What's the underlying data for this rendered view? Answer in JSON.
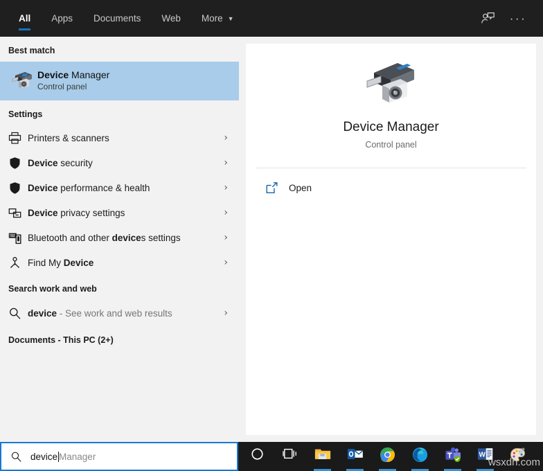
{
  "header": {
    "tabs": [
      {
        "label": "All",
        "active": true,
        "has_caret": false
      },
      {
        "label": "Apps",
        "active": false,
        "has_caret": false
      },
      {
        "label": "Documents",
        "active": false,
        "has_caret": false
      },
      {
        "label": "Web",
        "active": false,
        "has_caret": false
      },
      {
        "label": "More",
        "active": false,
        "has_caret": true
      }
    ],
    "caret_glyph": "▼",
    "feedback_icon": "feedback-person-icon",
    "more_options_icon": "ellipsis-icon",
    "more_options_glyph": "···",
    "background": "#1f1f1f",
    "accent": "#1773c0"
  },
  "left_panel": {
    "best_match": {
      "section_label": "Best match",
      "title_bold": "Device",
      "title_rest": " Manager",
      "subtitle": "Control panel",
      "highlight_color": "#a8ccea",
      "icon": "device-manager-icon"
    },
    "settings": {
      "section_label": "Settings",
      "items": [
        {
          "bold": "",
          "text": "Printers & scanners",
          "icon": "printer-icon",
          "chevron": "›"
        },
        {
          "bold": "Device",
          "text": " security",
          "icon": "shield-icon",
          "chevron": "›"
        },
        {
          "bold": "Device",
          "text": " performance & health",
          "icon": "shield-icon",
          "chevron": "›"
        },
        {
          "bold": "Device",
          "text": " privacy settings",
          "icon": "devices-icon",
          "chevron": "›"
        },
        {
          "pre": "Bluetooth and other ",
          "bold": "device",
          "text": "s settings",
          "icon": "bluetooth-devices-icon",
          "chevron": "›"
        },
        {
          "pre": "Find My ",
          "bold": "Device",
          "text": "",
          "icon": "find-my-device-icon",
          "chevron": "›"
        }
      ]
    },
    "search_work_web": {
      "section_label": "Search work and web",
      "query_bold": "device",
      "query_rest": " - See work and web results",
      "icon": "search-icon",
      "chevron": "›"
    },
    "documents_section": {
      "label": "Documents - This PC (2+)"
    }
  },
  "right_panel": {
    "app_icon": "device-manager-large-icon",
    "title": "Device Manager",
    "subtitle": "Control panel",
    "actions": [
      {
        "label": "Open",
        "icon": "open-external-icon"
      }
    ]
  },
  "taskbar": {
    "search": {
      "icon": "search-icon",
      "typed_value": "device",
      "autocomplete_suffix": " Manager",
      "border_color": "#1978d4"
    },
    "items": [
      {
        "name": "cortana-icon",
        "label": "Cortana",
        "running": false
      },
      {
        "name": "task-view-icon",
        "label": "Task View",
        "running": false
      },
      {
        "name": "file-explorer-icon",
        "label": "File Explorer",
        "running": true
      },
      {
        "name": "outlook-icon",
        "label": "Outlook",
        "running": true
      },
      {
        "name": "chrome-icon",
        "label": "Google Chrome",
        "running": true
      },
      {
        "name": "edge-icon",
        "label": "Microsoft Edge",
        "running": true
      },
      {
        "name": "teams-icon",
        "label": "Microsoft Teams",
        "running": true
      },
      {
        "name": "word-icon",
        "label": "Microsoft Word",
        "running": true
      },
      {
        "name": "paint-icon",
        "label": "Paint",
        "running": false
      }
    ]
  },
  "watermark": {
    "text": "wsxdn.com"
  }
}
